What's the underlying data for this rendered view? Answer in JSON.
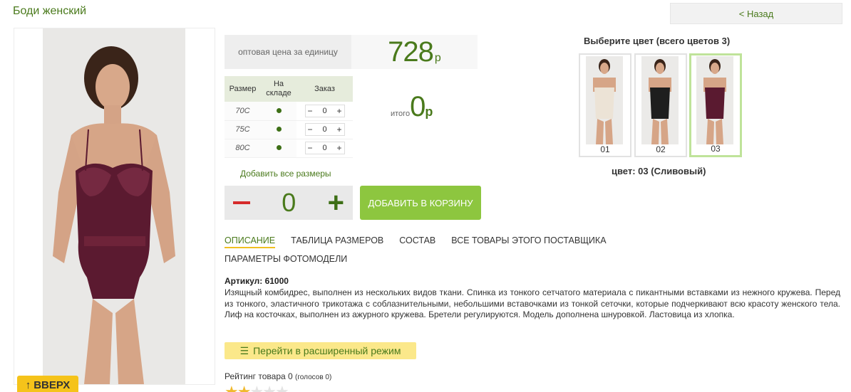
{
  "page": {
    "title": "Боди женский",
    "back_label": "< Назад"
  },
  "pricing": {
    "label": "оптовая цена за единицу",
    "value": "728",
    "currency": "р"
  },
  "size_table": {
    "headers": [
      "Размер",
      "На складе",
      "Заказ"
    ],
    "rows": [
      {
        "size": "70C",
        "qty": "0"
      },
      {
        "size": "75C",
        "qty": "0"
      },
      {
        "size": "80C",
        "qty": "0"
      }
    ]
  },
  "total": {
    "label": "итого",
    "value": "0",
    "currency": "р"
  },
  "add_all_sizes": "Добавить все размеры",
  "quantity": {
    "value": "0"
  },
  "cart_button": "ДОБАВИТЬ В КОРЗИНУ",
  "tabs": [
    "ОПИСАНИЕ",
    "ТАБЛИЦА РАЗМЕРОВ",
    "СОСТАВ",
    "ВСЕ ТОВАРЫ ЭТОГО ПОСТАВЩИКА",
    "ПАРАМЕТРЫ ФОТОМОДЕЛИ"
  ],
  "description": {
    "sku": "Артикул: 61000",
    "text": "Изящный комбидрес, выполнен из нескольких видов ткани. Спинка из тонкого сетчатого материала с пикантными вставками из нежного кружева. Перед из тонкого, эластичного трикотажа с соблазнительными, небольшими вставочками из тонкой сеточки, которые подчеркивают всю красоту женского тела. Лиф на косточках, выполнен из ажурного кружева. Бретели регулируются. Модель дополнена шнуровкой. Ластовица из хлопка."
  },
  "advanced_mode": "Перейти в расширенный режим",
  "rating": {
    "label": "Рейтинг товара 0",
    "votes": "(голосов 0)"
  },
  "colors": {
    "title": "Выберите цвет (всего цветов 3)",
    "items": [
      {
        "num": "01",
        "color": "#ece3d6"
      },
      {
        "num": "02",
        "color": "#1e1e1e"
      },
      {
        "num": "03",
        "color": "#5a1a30"
      }
    ],
    "selected_label": "цвет: 03 (Сливовый)"
  },
  "up_button": "ВВЕРХ",
  "icons": {
    "up": "arrow-up-icon",
    "advanced": "list-icon",
    "star": "star-icon"
  },
  "accent_colors": {
    "green": "#4a7a1c",
    "cart": "#8dc63f",
    "minus": "#d62b2b",
    "yellow": "#f5c31a"
  }
}
